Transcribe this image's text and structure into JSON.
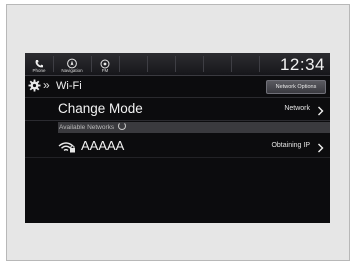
{
  "statusbar": {
    "items": [
      {
        "label": "Phone",
        "icon": "phone-icon"
      },
      {
        "label": "Navigation",
        "icon": "compass-icon"
      },
      {
        "label": "FM",
        "icon": "radio-icon"
      }
    ],
    "clock": "12:34"
  },
  "header": {
    "breadcrumb_icon": "gear-icon",
    "title": "Wi-Fi",
    "options_button": "Network Options"
  },
  "change_mode": {
    "label": "Change Mode",
    "value": "Network"
  },
  "available_networks": {
    "section_label": "Available Networks",
    "items": [
      {
        "name": "AAAAA",
        "status": "Obtaining IP",
        "icon": "wifi-locked-icon"
      }
    ]
  },
  "colors": {
    "screen_bg": "#0c0c0e",
    "text": "#f2f2f2",
    "section_bg": "#3a3a3e",
    "frame_bg": "#e6e6e6"
  }
}
